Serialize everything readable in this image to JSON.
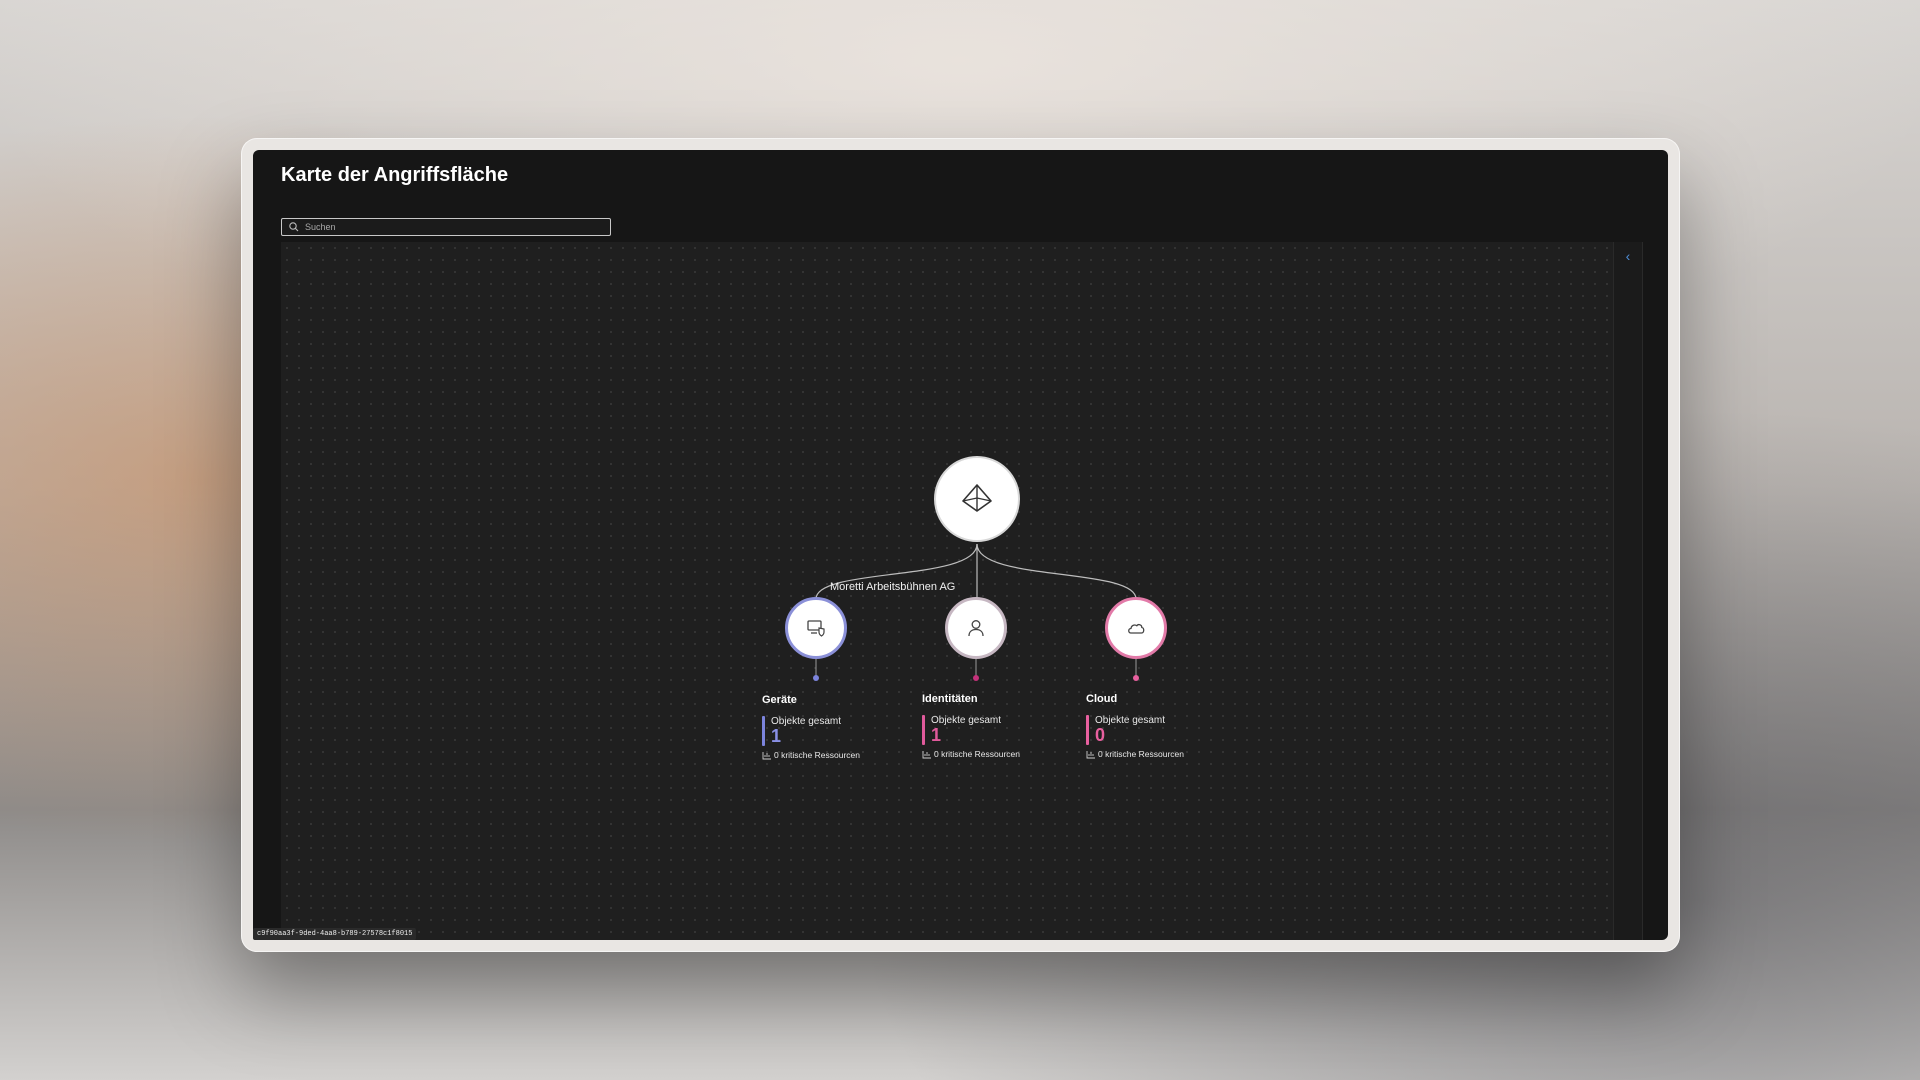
{
  "page": {
    "title": "Karte der Angriffsfläche"
  },
  "search": {
    "placeholder": "Suchen"
  },
  "graph": {
    "organization": "Moretti Arbeitsbühnen AG",
    "categories": [
      {
        "key": "devices",
        "title": "Geräte",
        "stat_label": "Objekte gesamt",
        "total": "1",
        "critical": "0 kritische Ressourcen",
        "accent": "#7c84dc",
        "icon": "device-shield-icon"
      },
      {
        "key": "identities",
        "title": "Identitäten",
        "stat_label": "Objekte gesamt",
        "total": "1",
        "critical": "0 kritische Ressourcen",
        "accent": "#e05a9b",
        "icon": "person-icon"
      },
      {
        "key": "cloud",
        "title": "Cloud",
        "stat_label": "Objekte gesamt",
        "total": "0",
        "critical": "0 kritische Ressourcen",
        "accent": "#e8609f",
        "icon": "cloud-icon"
      }
    ]
  },
  "footer": {
    "session_id": "c9f90aa3f-9ded-4aa8-b789-27578c1f8015"
  }
}
